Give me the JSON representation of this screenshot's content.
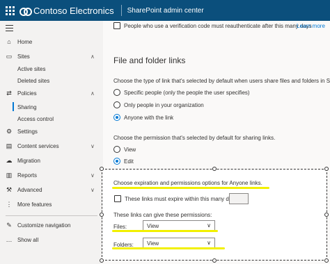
{
  "header": {
    "brand": "Contoso Electronics",
    "app_title": "SharePoint admin center",
    "bg_color": "#0b4f7c"
  },
  "sidebar": {
    "items": [
      {
        "label": "Home",
        "icon": "home-icon"
      },
      {
        "label": "Sites",
        "icon": "sites-icon",
        "expanded": true
      },
      {
        "label": "Active sites"
      },
      {
        "label": "Deleted sites"
      },
      {
        "label": "Policies",
        "icon": "policies-icon",
        "expanded": true
      },
      {
        "label": "Sharing",
        "selected": true
      },
      {
        "label": "Access control"
      },
      {
        "label": "Settings",
        "icon": "gear-icon"
      },
      {
        "label": "Content services",
        "icon": "content-services-icon",
        "expanded": false
      },
      {
        "label": "Migration",
        "icon": "migration-icon"
      },
      {
        "label": "Reports",
        "icon": "reports-icon",
        "expanded": false
      },
      {
        "label": "Advanced",
        "icon": "advanced-icon",
        "expanded": false
      },
      {
        "label": "More features",
        "icon": "more-features-icon"
      },
      {
        "label": "Customize navigation",
        "icon": "edit-icon"
      },
      {
        "label": "Show all",
        "icon": "ellipsis-icon"
      }
    ]
  },
  "main": {
    "verification_checkbox": "People who use a verification code must reauthenticate after this many days",
    "learn_more": "Learn more",
    "file_folder_title": "File and folder links",
    "link_type_question": "Choose the type of link that's selected by default when users share files and folders in S",
    "link_type_options": [
      {
        "label": "Specific people (only the people the user specifies)",
        "selected": false
      },
      {
        "label": "Only people in your organization",
        "selected": false
      },
      {
        "label": "Anyone with the link",
        "selected": true
      }
    ],
    "permission_question": "Choose the permission that's selected by default for sharing links.",
    "permission_options": [
      {
        "label": "View",
        "selected": false
      },
      {
        "label": "Edit",
        "selected": true
      }
    ],
    "expiration_title": "Choose expiration and permissions options for Anyone links.",
    "expire_checkbox": "These links must expire within this many days",
    "expire_days_value": "",
    "permissions_label": "These links can give these permissions:",
    "files_label": "Files:",
    "files_value": "View",
    "folders_label": "Folders:",
    "folders_value": "View",
    "highlight_color": "#f2f000",
    "accent_color": "#0078d4"
  }
}
